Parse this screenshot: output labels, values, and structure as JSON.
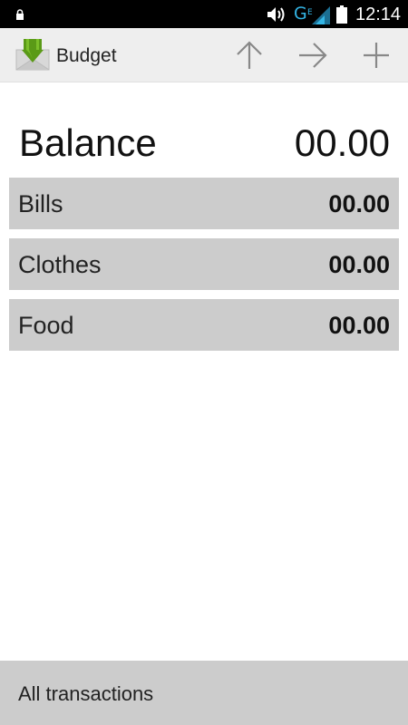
{
  "status_bar": {
    "network": "G",
    "time": "12:14",
    "icons": [
      "lock-icon",
      "volume-icon",
      "signal-icon",
      "battery-icon"
    ]
  },
  "action_bar": {
    "title": "Budget",
    "app_icon": "budget-envelope-icon",
    "actions": [
      "arrow-up-icon",
      "arrow-right-icon",
      "plus-icon"
    ]
  },
  "balance": {
    "label": "Balance",
    "value": "00.00"
  },
  "categories": [
    {
      "name": "Bills",
      "amount": "00.00"
    },
    {
      "name": "Clothes",
      "amount": "00.00"
    },
    {
      "name": "Food",
      "amount": "00.00"
    }
  ],
  "footer": {
    "all_transactions_label": "All transactions"
  },
  "colors": {
    "status_bar_bg": "#000000",
    "action_bar_bg": "#eeeeee",
    "row_bg": "#cccccc",
    "network_accent": "#33b5e5",
    "app_icon_green": "#5a9a17"
  }
}
